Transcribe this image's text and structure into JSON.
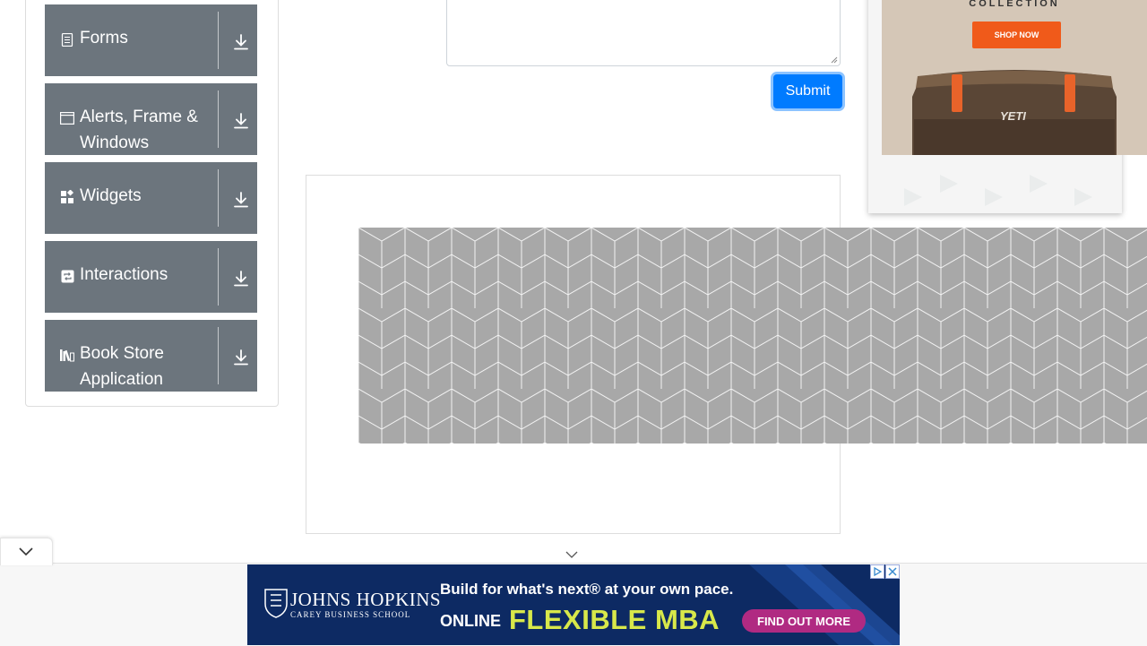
{
  "sidebar": {
    "groups": [
      {
        "title": "Forms",
        "icon": "document-icon"
      },
      {
        "title": "Alerts, Frame & Windows",
        "icon": "window-icon"
      },
      {
        "title": "Widgets",
        "icon": "widgets-icon"
      },
      {
        "title": "Interactions",
        "icon": "repeat-icon"
      },
      {
        "title": "Book Store Application",
        "icon": "books-icon"
      }
    ]
  },
  "form": {
    "submit_label": "Submit"
  },
  "ads": {
    "right": {
      "collection_text": "COLLECTION",
      "shop_now": "SHOP NOW",
      "brand_mark": "YETI"
    },
    "bottom": {
      "school_name": "JOHNS HOPKINS",
      "school_sub": "CAREY BUSINESS SCHOOL",
      "headline": "Build for what's next® at your own pace.",
      "online": "ONLINE",
      "program": "FLEXIBLE MBA",
      "cta": "FIND OUT MORE"
    }
  },
  "colors": {
    "sidebar_bg": "#6c757d",
    "submit_bg": "#007bff",
    "ad_blue": "#0d2a63",
    "ad_green": "#d8e84a",
    "ad_pink": "#b02a82",
    "shop_orange": "#f05a1a"
  }
}
